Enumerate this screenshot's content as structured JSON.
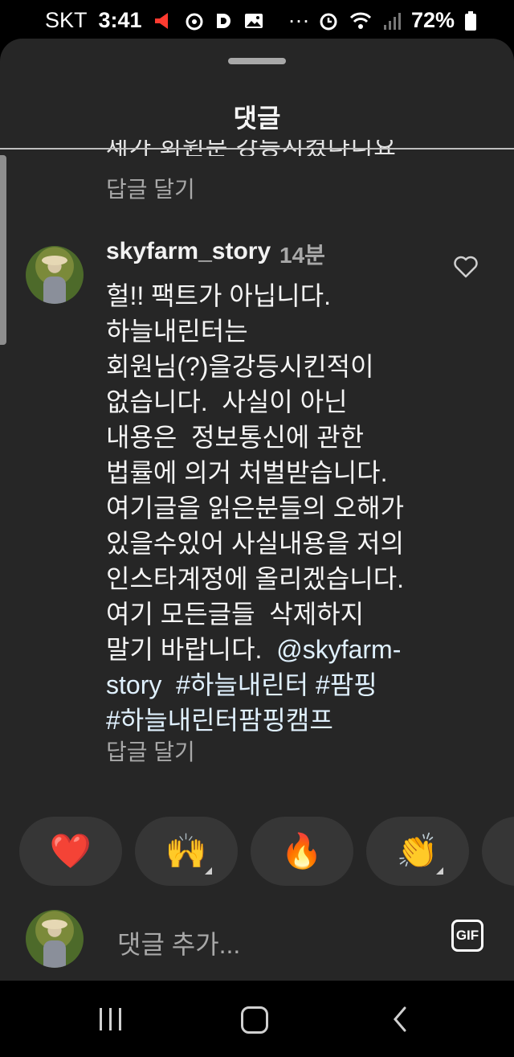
{
  "status_bar": {
    "carrier": "SKT",
    "time": "3:41",
    "dots": "···",
    "battery": "72%",
    "icons": [
      "megaphone-icon",
      "record-icon",
      "d-app-icon",
      "image-icon",
      "alarm-icon",
      "wifi-icon",
      "signal-icon",
      "battery-icon"
    ]
  },
  "sheet": {
    "title": "댓글",
    "prev_cut_text": "제가 회원분 강등시켰다니요",
    "prev_reply": "답글 달기"
  },
  "comment": {
    "username": "skyfarm_story",
    "time": "14분",
    "body_plain": "헐!! 팩트가 아닙니다.\n하늘내린터는\n회원님(?)을강등시킨적이\n없습니다.  사실이 아닌\n내용은  정보통신에 관한\n법률에 의거 처벌받습니다.\n여기글을 읽은분들의 오해가\n있을수있어 사실내용을 저의\n인스타계정에 올리겠습니다.\n여기 모든글들  삭제하지\n말기 바랍니다.  ",
    "mention_a": "@skyfarm-",
    "mention_b": "story",
    "spacer": "  ",
    "tag1": "#하늘내린터",
    "tag2": "#팜핑",
    "tag3": "#하늘내린터팜핑캠프",
    "reply": "답글 달기"
  },
  "reactions": [
    {
      "emoji": "❤️",
      "icon": "heart-emoji-icon"
    },
    {
      "emoji": "🙌",
      "icon": "raised-hands-emoji-icon"
    },
    {
      "emoji": "🔥",
      "icon": "fire-emoji-icon"
    },
    {
      "emoji": "👏",
      "icon": "clapping-emoji-icon"
    }
  ],
  "composer": {
    "placeholder": "댓글 추가...",
    "gif_label": "GIF"
  },
  "colors": {
    "sheet_bg": "#262626",
    "secondary_text": "#a8a8a8",
    "hashtag": "#e0f1ff",
    "alert_red": "#ff3b30"
  }
}
